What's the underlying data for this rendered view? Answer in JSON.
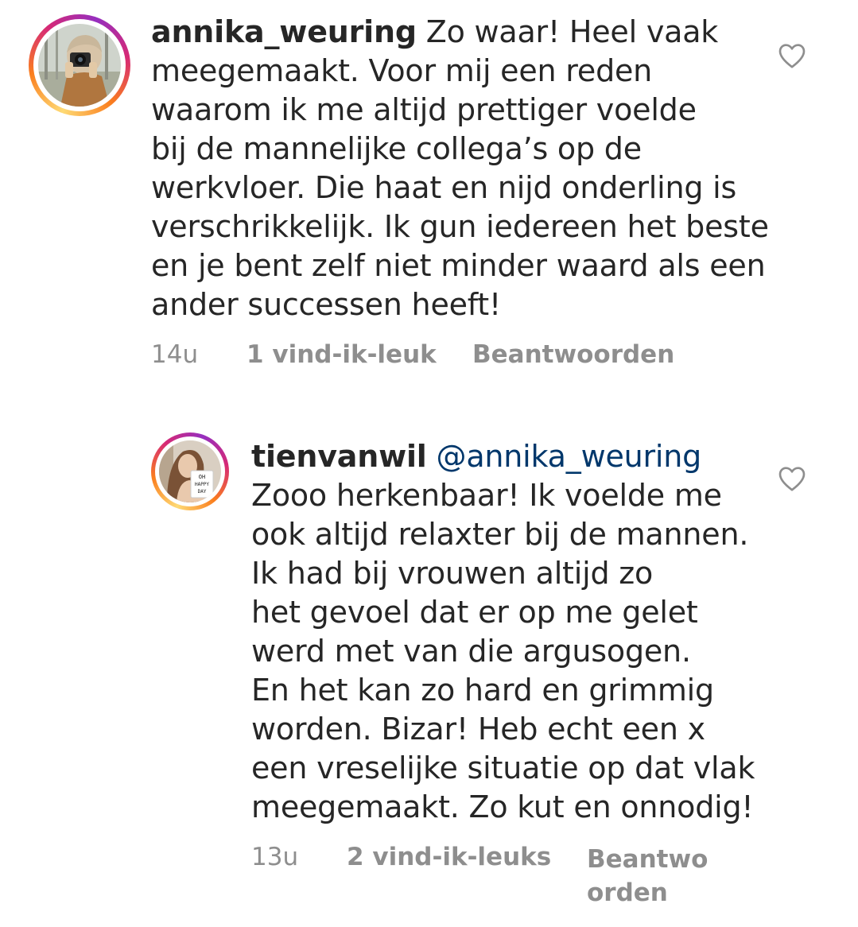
{
  "comments": [
    {
      "username": "annika_weuring",
      "mention": "",
      "lines": [
        "Zo waar! Heel vaak",
        "meegemaakt. Voor mij een reden",
        "waarom ik me altijd prettiger voelde",
        "bij de mannelijke collega’s op de",
        "werkvloer. Die haat en nijd onderling is",
        "verschrikkelijk. Ik gun iedereen het beste",
        "en je bent zelf niet minder waard als een",
        "ander successen heeft!"
      ],
      "time": "14u",
      "likes": "1 vind-ik-leuk",
      "reply": "Beantwoorden",
      "avatar": "photographer-avatar"
    },
    {
      "username": "tienvanwil",
      "mention": "@annika_weuring",
      "lines": [
        "Zooo herkenbaar! Ik voelde me",
        "ook altijd relaxter bij de mannen.",
        "Ik had bij vrouwen altijd zo",
        "het gevoel dat er op me gelet",
        "werd met van die argusogen.",
        "En het kan zo hard en grimmig",
        "worden. Bizar! Heb echt een x",
        "een vreselijke situatie op dat vlak",
        "meegemaakt. Zo kut en onnodig!"
      ],
      "time": "13u",
      "likes": "2 vind-ik-leuks",
      "reply_line1": "Beantwo",
      "reply_line2": "orden",
      "avatar": "oh-happy-day-avatar",
      "avatar_text": [
        "OH",
        "HAPPY",
        "DAY"
      ]
    }
  ],
  "icons": {
    "like": "heart-outline-icon"
  },
  "colors": {
    "text": "#262626",
    "meta": "#8e8e8e",
    "mention": "#00376b"
  }
}
